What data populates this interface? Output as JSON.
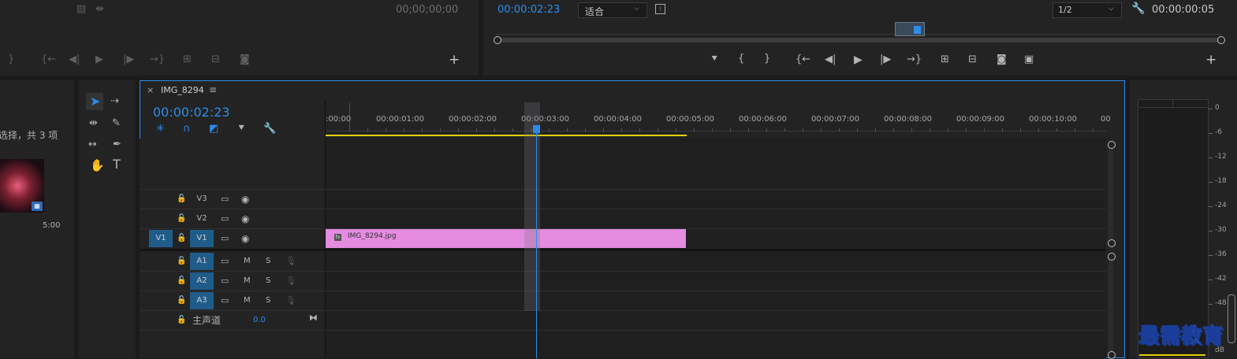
{
  "source_monitor": {
    "timecode": "00;00;00;00"
  },
  "program_monitor": {
    "timecode_current": "00:00:02:23",
    "fit_select": "适合",
    "resolution_select": "1/2",
    "timecode_duration": "00:00:00:05"
  },
  "project_panel": {
    "selection_text": "选择，共 3 项",
    "thumb_duration": "5:00"
  },
  "timeline": {
    "close_label": "×",
    "sequence_name": "IMG_8294",
    "menu_label": "≡",
    "timecode": "00:00:02:23",
    "ruler_labels": [
      ":00:00",
      "00:00:01:00",
      "00:00:02:00",
      "00:00:03:00",
      "00:00:04:00",
      "00:00:05:00",
      "00:00:06:00",
      "00:00:07:00",
      "00:00:08:00",
      "00:00:09:00",
      "00:00:10:00",
      "00"
    ],
    "video_tracks": [
      {
        "name": "V3",
        "source": ""
      },
      {
        "name": "V2",
        "source": ""
      },
      {
        "name": "V1",
        "source": "V1"
      }
    ],
    "audio_tracks": [
      {
        "name": "A1",
        "m": "M",
        "s": "S"
      },
      {
        "name": "A2",
        "m": "M",
        "s": "S"
      },
      {
        "name": "A3",
        "m": "M",
        "s": "S"
      }
    ],
    "master": {
      "label": "主声道",
      "value": "0.0"
    },
    "clip": {
      "name": "IMG_8294.jpg",
      "fx": "fx",
      "color": "#e58be0"
    }
  },
  "audio_meter": {
    "db_labels": [
      "0",
      "-6",
      "-12",
      "-18",
      "-24",
      "-30",
      "-36",
      "-42",
      "-48",
      "dB"
    ]
  },
  "watermark": "最需教育",
  "colors": {
    "accent_blue": "#2d8ceb",
    "clip_pink": "#e58be0",
    "work_area_yellow": "#e4d000"
  }
}
